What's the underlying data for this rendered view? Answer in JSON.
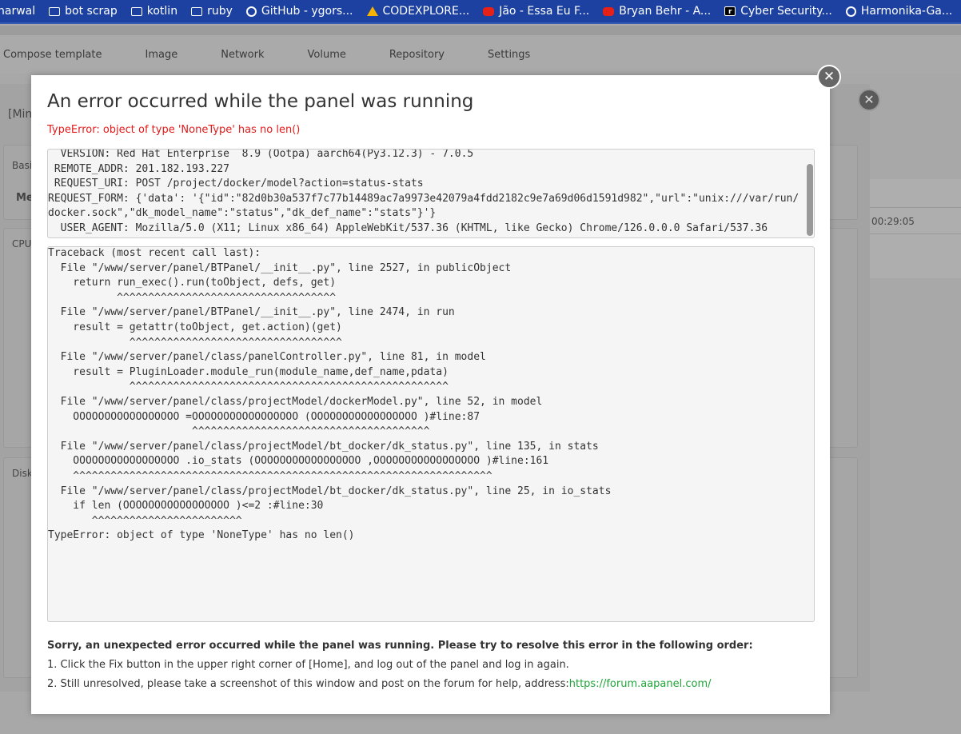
{
  "bookmarks": [
    {
      "label": "narwal",
      "icon": "none"
    },
    {
      "label": "bot scrap",
      "icon": "folder-icon"
    },
    {
      "label": "kotlin",
      "icon": "folder-icon"
    },
    {
      "label": "ruby",
      "icon": "folder-icon"
    },
    {
      "label": "GitHub - ygors...",
      "icon": "github-icon"
    },
    {
      "label": "CODEXPLORE...",
      "icon": "drive-icon"
    },
    {
      "label": "Jão - Essa Eu F...",
      "icon": "youtube-icon"
    },
    {
      "label": "Bryan Behr - A...",
      "icon": "youtube-icon"
    },
    {
      "label": "Cyber Security...",
      "icon": "site-icon"
    },
    {
      "label": "Harmonika-Ga...",
      "icon": "github-icon"
    }
  ],
  "tabs": [
    "Compose template",
    "Image",
    "Network",
    "Volume",
    "Repository",
    "Settings"
  ],
  "background": {
    "title": "[Min",
    "box1": "Basi",
    "box1b": "Me",
    "cpu": "CPU",
    "disk": "Disk",
    "time": "00:29:05"
  },
  "modal": {
    "title": "An error occurred while the panel was running",
    "error": "TypeError: object of type 'NoneType' has no len()",
    "request_info": "  VERSION: Red Hat Enterprise  8.9 (Ootpa) aarch64(Py3.12.3) - 7.0.5\n REMOTE_ADDR: 201.182.193.227\n REQUEST_URI: POST /project/docker/model?action=status-stats\nREQUEST_FORM: {'data': '{\"id\":\"82d0b30a537f7c77b14489ac7a9973e42079a4fdd2182c9e7a69d06d1591d982\",\"url\":\"unix:///var/run/docker.sock\",\"dk_model_name\":\"status\",\"dk_def_name\":\"stats\"}'}\n  USER_AGENT: Mozilla/5.0 (X11; Linux x86_64) AppleWebKit/537.36 (KHTML, like Gecko) Chrome/126.0.0.0 Safari/537.36",
    "traceback": "Traceback (most recent call last):\n  File \"/www/server/panel/BTPanel/__init__.py\", line 2527, in publicObject\n    return run_exec().run(toObject, defs, get)\n           ^^^^^^^^^^^^^^^^^^^^^^^^^^^^^^^^^^^\n  File \"/www/server/panel/BTPanel/__init__.py\", line 2474, in run\n    result = getattr(toObject, get.action)(get)\n             ^^^^^^^^^^^^^^^^^^^^^^^^^^^^^^^^^^\n  File \"/www/server/panel/class/panelController.py\", line 81, in model\n    result = PluginLoader.module_run(module_name,def_name,pdata)\n             ^^^^^^^^^^^^^^^^^^^^^^^^^^^^^^^^^^^^^^^^^^^^^^^^^^^\n  File \"/www/server/panel/class/projectModel/dockerModel.py\", line 52, in model\n    OOOOOOOOOOOOOOOOO =OOOOOOOOOOOOOOOOO (OOOOOOOOOOOOOOOOO )#line:87\n                       ^^^^^^^^^^^^^^^^^^^^^^^^^^^^^^^^^^^^^^\n  File \"/www/server/panel/class/projectModel/bt_docker/dk_status.py\", line 135, in stats\n    OOOOOOOOOOOOOOOOO .io_stats (OOOOOOOOOOOOOOOOO ,OOOOOOOOOOOOOOOOO )#line:161\n    ^^^^^^^^^^^^^^^^^^^^^^^^^^^^^^^^^^^^^^^^^^^^^^^^^^^^^^^^^^^^^^^^^^^\n  File \"/www/server/panel/class/projectModel/bt_docker/dk_status.py\", line 25, in io_stats\n    if len (OOOOOOOOOOOOOOOOO )<=2 :#line:30\n       ^^^^^^^^^^^^^^^^^^^^^^^^\nTypeError: object of type 'NoneType' has no len()",
    "help_title": "Sorry, an unexpected error occurred while the panel was running. Please try to resolve this error in the following order:",
    "help_step1": "1. Click the Fix button in the upper right corner of [Home], and log out of the panel and log in again.",
    "help_step2": "2. Still unresolved, please take a screenshot of this window and post on the forum for help, address:",
    "forum_link": "https://forum.aapanel.com/",
    "close_glyph": "✕"
  },
  "colors": {
    "error": "#e21b1b",
    "link": "#20a53a",
    "bookmark_bar": "#1c41a0"
  }
}
